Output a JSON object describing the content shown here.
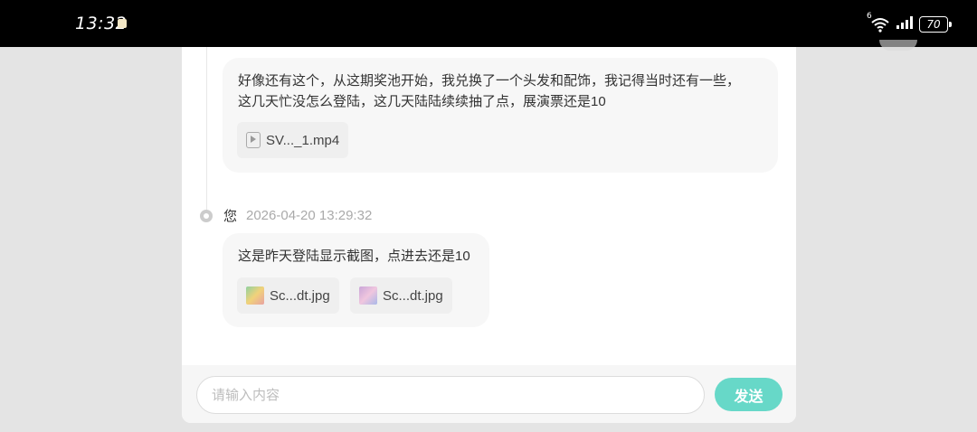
{
  "status_bar": {
    "time": "13:32",
    "network": "6",
    "battery": "70"
  },
  "messages": [
    {
      "text_lines": [
        "好像还有这个，从这期奖池开始，我兑换了一个头发和配饰，我记得当时还有一些，",
        "这几天忙没怎么登陆，这几天陆陆续续抽了点，展演票还是10"
      ],
      "attachments": [
        {
          "name": "SV..._1.mp4",
          "icon": "video-file-icon"
        }
      ]
    },
    {
      "sender": "您",
      "timestamp": "2026-04-20 13:29:32",
      "text_lines": [
        "这是昨天登陆显示截图，点进去还是10"
      ],
      "attachments": [
        {
          "name": "Sc...dt.jpg",
          "icon": "image-thumbnail-icon",
          "color": "#8fd1a0"
        },
        {
          "name": "Sc...dt.jpg",
          "icon": "image-thumbnail-icon",
          "color": "#c9a6d8"
        }
      ]
    }
  ],
  "composer": {
    "placeholder": "请输入内容",
    "send_label": "发送",
    "accent": "#67d8c8"
  }
}
